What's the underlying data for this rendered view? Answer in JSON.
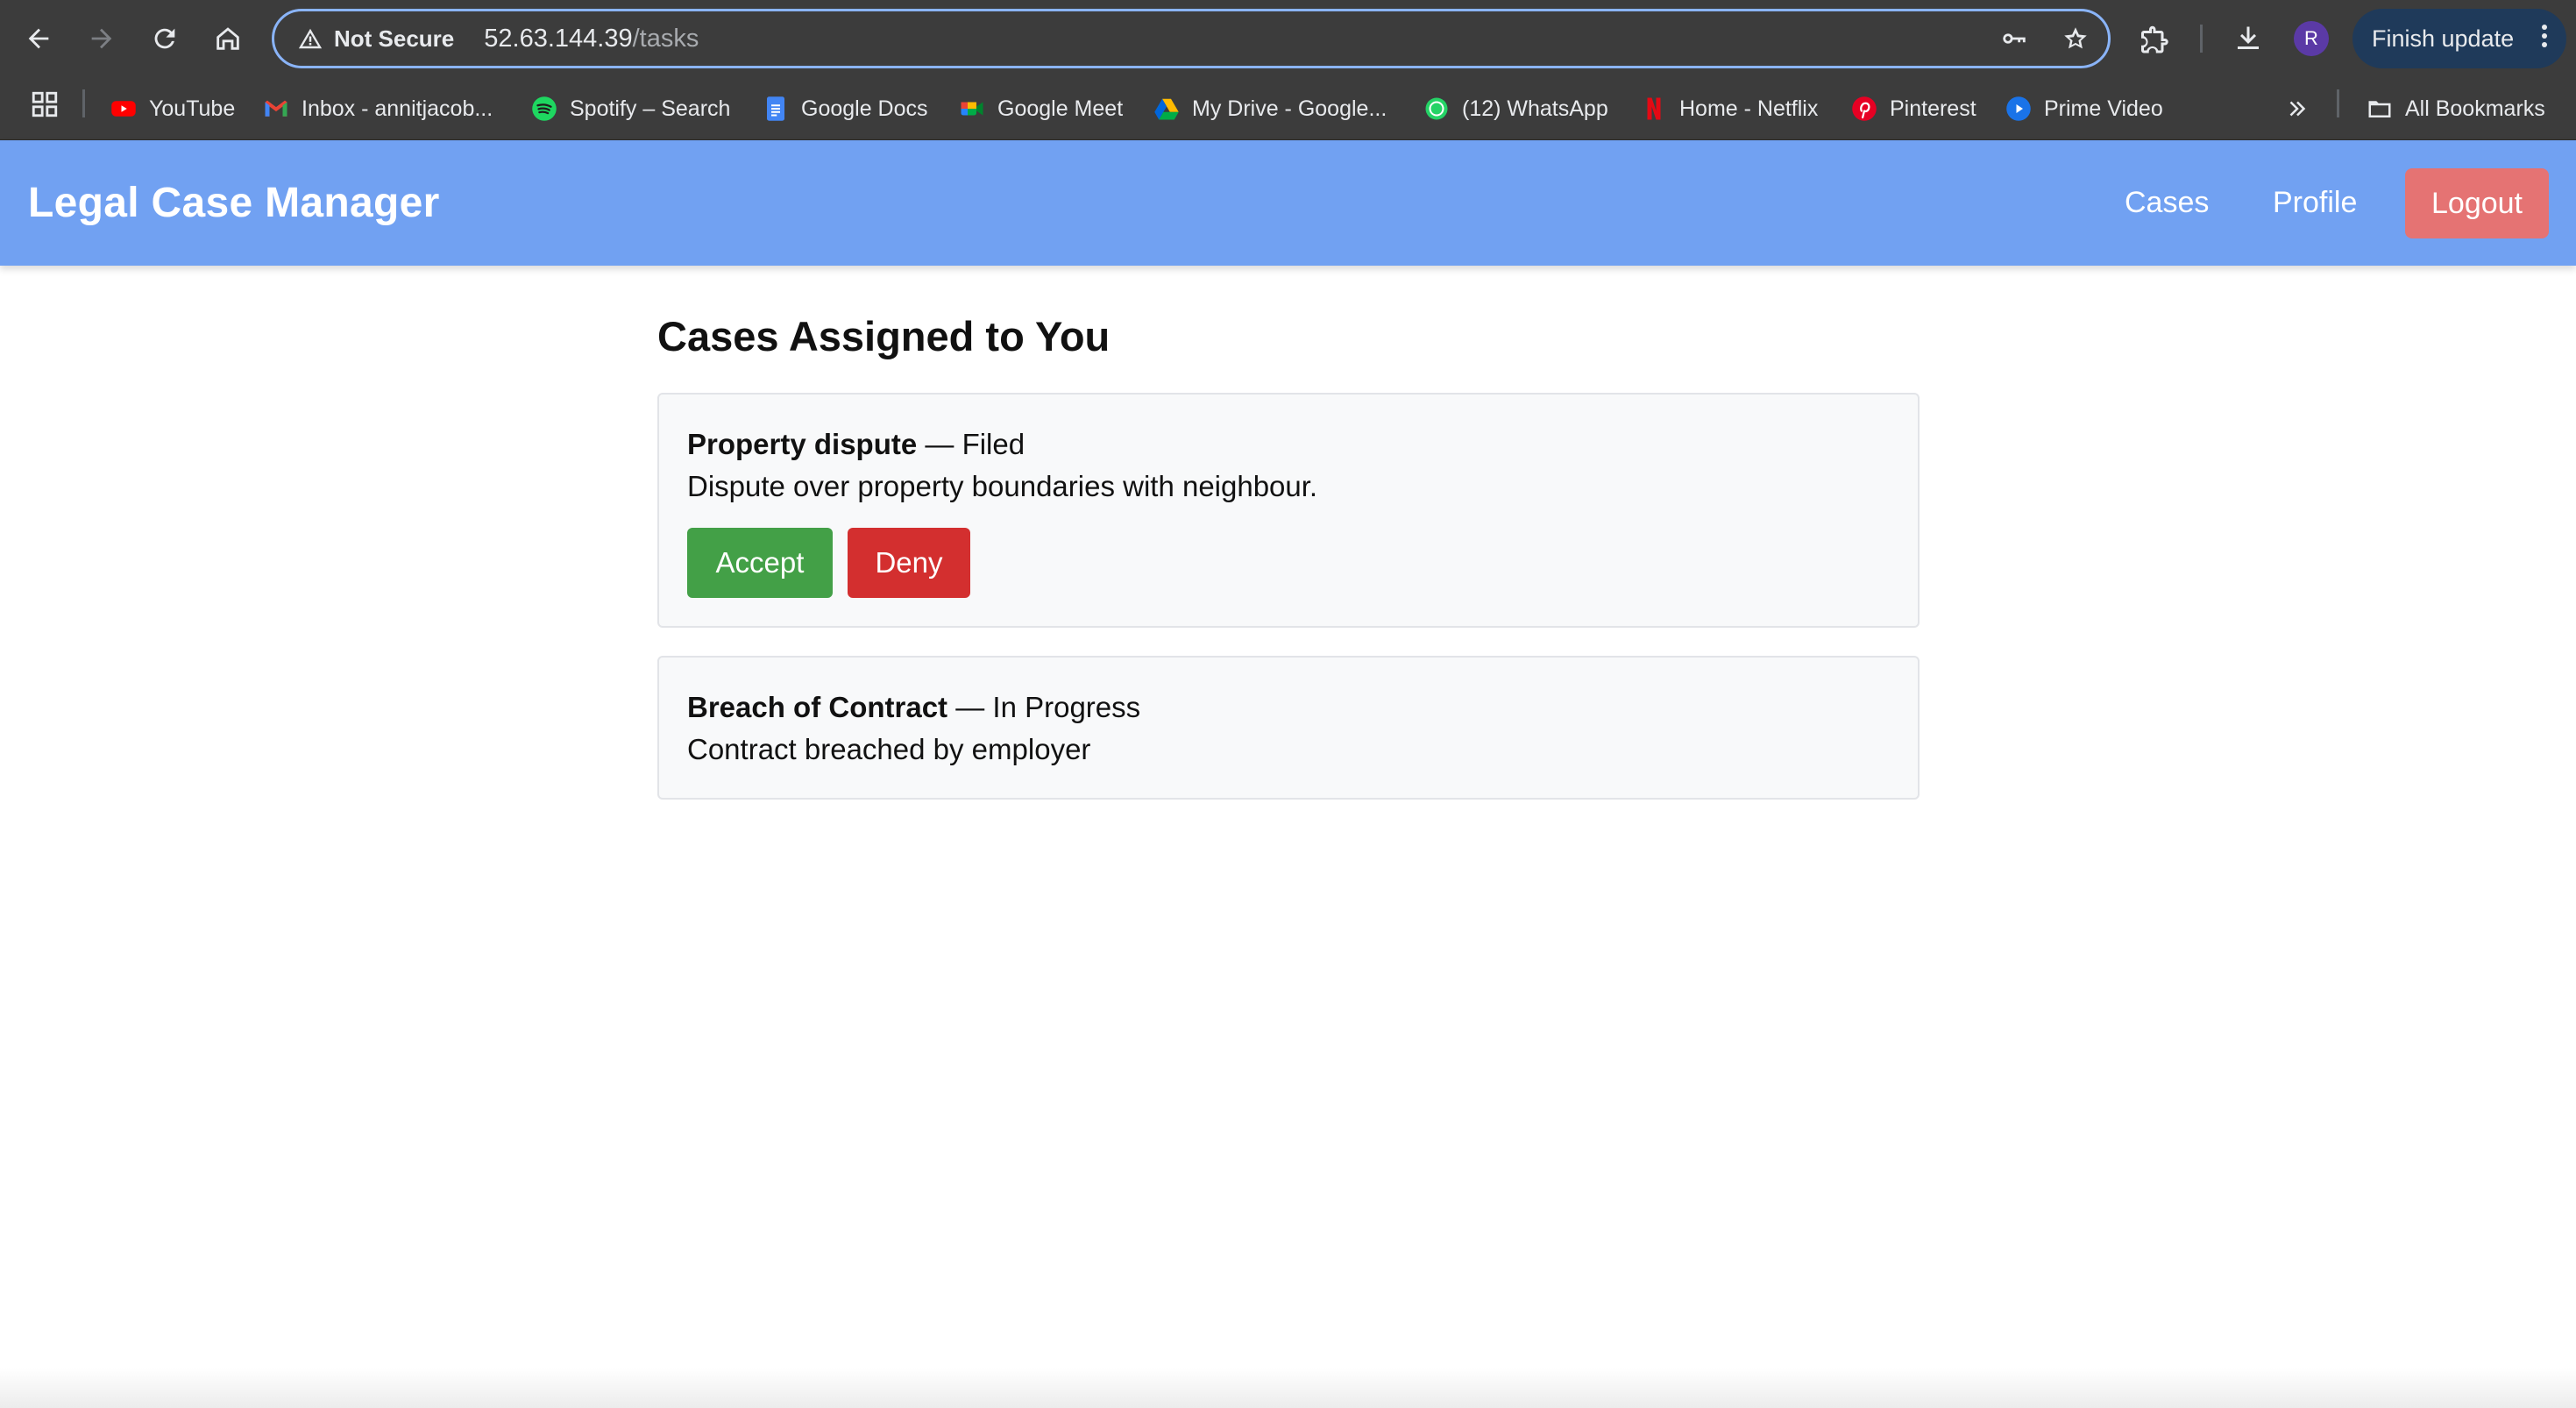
{
  "browser": {
    "security_label": "Not Secure",
    "url_host": "52.63.144.39",
    "url_path": "/tasks",
    "avatar_letter": "R",
    "finish_update_label": "Finish update",
    "bookmarks": [
      {
        "label": "YouTube",
        "icon": "youtube-icon"
      },
      {
        "label": "Inbox - annitjacob...",
        "icon": "gmail-icon"
      },
      {
        "label": "Spotify – Search",
        "icon": "spotify-icon"
      },
      {
        "label": "Google Docs",
        "icon": "docs-icon"
      },
      {
        "label": "Google Meet",
        "icon": "meet-icon"
      },
      {
        "label": "My Drive - Google...",
        "icon": "drive-icon"
      },
      {
        "label": "(12) WhatsApp",
        "icon": "whatsapp-icon"
      },
      {
        "label": "Home - Netflix",
        "icon": "netflix-icon"
      },
      {
        "label": "Pinterest",
        "icon": "pinterest-icon"
      },
      {
        "label": "Prime Video",
        "icon": "prime-video-icon"
      }
    ],
    "all_bookmarks_label": "All Bookmarks"
  },
  "app": {
    "brand": "Legal Case Manager",
    "nav": {
      "cases": "Cases",
      "profile": "Profile",
      "logout": "Logout"
    },
    "colors": {
      "navbar": "#71a1f2",
      "logout": "#e57373",
      "accept": "#43a047",
      "deny": "#d32f2f"
    }
  },
  "main": {
    "title": "Cases Assigned to You",
    "cases": [
      {
        "name": "Property dispute",
        "separator": " — ",
        "status": "Filed",
        "description": "Dispute over property boundaries with neighbour.",
        "accept_label": "Accept",
        "deny_label": "Deny"
      },
      {
        "name": "Breach of Contract",
        "separator": " — ",
        "status": "In Progress",
        "description": "Contract breached by employer"
      }
    ]
  }
}
